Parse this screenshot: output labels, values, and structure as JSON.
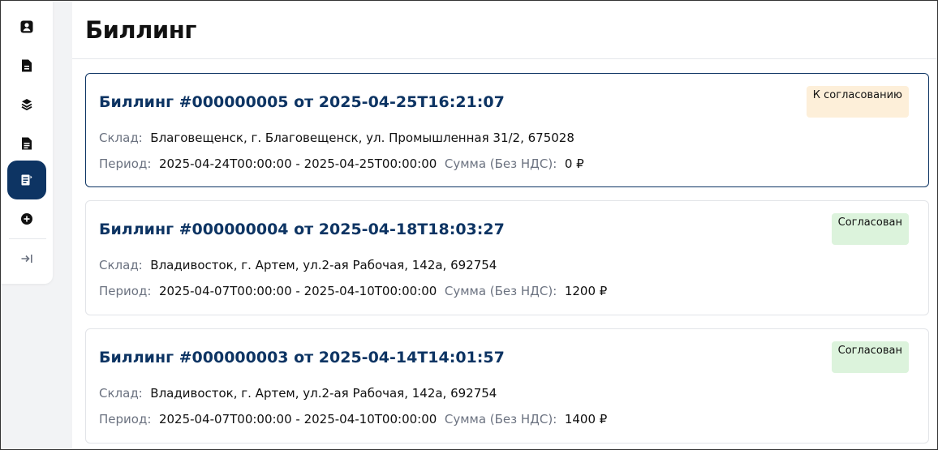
{
  "page": {
    "title": "Биллинг"
  },
  "sidebar": {
    "items": [
      {
        "icon": "user-profile-icon",
        "active": false
      },
      {
        "icon": "document-icon",
        "active": false
      },
      {
        "icon": "layers-icon",
        "active": false
      },
      {
        "icon": "document-list-icon",
        "active": false
      },
      {
        "icon": "billing-icon",
        "active": true
      },
      {
        "icon": "add-circle-icon",
        "active": false
      },
      {
        "icon": "expand-sidebar-icon",
        "active": false
      }
    ]
  },
  "labels": {
    "warehouse": "Склад:",
    "period": "Период:",
    "amount": "Сумма (Без НДС):"
  },
  "billings": [
    {
      "title": "Биллинг #000000005 от 2025-04-25T16:21:07",
      "warehouse": "Благовещенск, г. Благовещенск, ул. Промышленная 31/2, 675028",
      "period": "2025-04-24T00:00:00 - 2025-04-25T00:00:00",
      "amount": "0 ₽",
      "status": "К согласованию"
    },
    {
      "title": "Биллинг #000000004 от 2025-04-18T18:03:27",
      "warehouse": "Владивосток, г. Артем, ул.2-ая Рабочая, 142а, 692754",
      "period": "2025-04-07T00:00:00 - 2025-04-10T00:00:00",
      "amount": "1200 ₽",
      "status": "Согласован"
    },
    {
      "title": "Биллинг #000000003 от 2025-04-14T14:01:57",
      "warehouse": "Владивосток, г. Артем, ул.2-ая Рабочая, 142а, 692754",
      "period": "2025-04-07T00:00:00 - 2025-04-10T00:00:00",
      "amount": "1400 ₽",
      "status": "Согласован"
    }
  ],
  "colors": {
    "accent": "#0d3463",
    "status_pending_bg": "#fdefd9",
    "status_approved_bg": "#dcf3dc"
  }
}
